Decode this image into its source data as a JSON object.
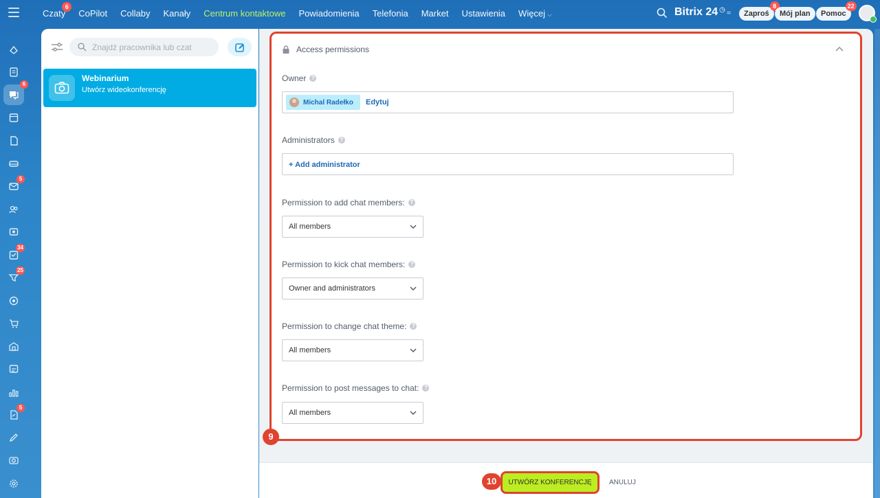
{
  "topnav": {
    "items": [
      {
        "label": "Czaty",
        "badge": "6"
      },
      {
        "label": "CoPilot"
      },
      {
        "label": "Collaby"
      },
      {
        "label": "Kanały"
      },
      {
        "label": "Centrum kontaktowe"
      },
      {
        "label": "Powiadomienia"
      },
      {
        "label": "Telefonia"
      },
      {
        "label": "Market"
      },
      {
        "label": "Ustawienia"
      },
      {
        "label": "Więcej"
      }
    ],
    "active_index": 4,
    "brand": "Bitrix",
    "brand_num": "24",
    "invite_label": "Zaproś",
    "invite_badge": "8",
    "plan_label": "Mój plan",
    "help_label": "Pomoc",
    "help_badge": "22"
  },
  "sidebar_badges": {
    "chat": "6",
    "mail": "5",
    "tasks": "34",
    "crm": "25",
    "sign": "5"
  },
  "chatlist": {
    "search_placeholder": "Znajdź pracownika lub czat",
    "item_title": "Webinarium",
    "item_subtitle": "Utwórz wideokonferencję"
  },
  "permissions": {
    "header": "Access permissions",
    "owner_label": "Owner",
    "owner_name": "Michal Radełko",
    "edit_label": "Edytuj",
    "admins_label": "Administrators",
    "add_admin": "+ Add administrator",
    "add_members_label": "Permission to add chat members:",
    "add_members_value": "All members",
    "kick_members_label": "Permission to kick chat members:",
    "kick_members_value": "Owner and administrators",
    "change_theme_label": "Permission to change chat theme:",
    "change_theme_value": "All members",
    "post_messages_label": "Permission to post messages to chat:",
    "post_messages_value": "All members"
  },
  "steps": {
    "step9": "9",
    "step10": "10"
  },
  "footer": {
    "create_label": "UTWÓRZ KONFERENCJĘ",
    "cancel_label": "ANULUJ"
  },
  "colors": {
    "accent_green": "#bbed21",
    "highlight_red": "#e0432f",
    "chat_active": "#00ace3",
    "link_blue": "#1f6ab5"
  }
}
